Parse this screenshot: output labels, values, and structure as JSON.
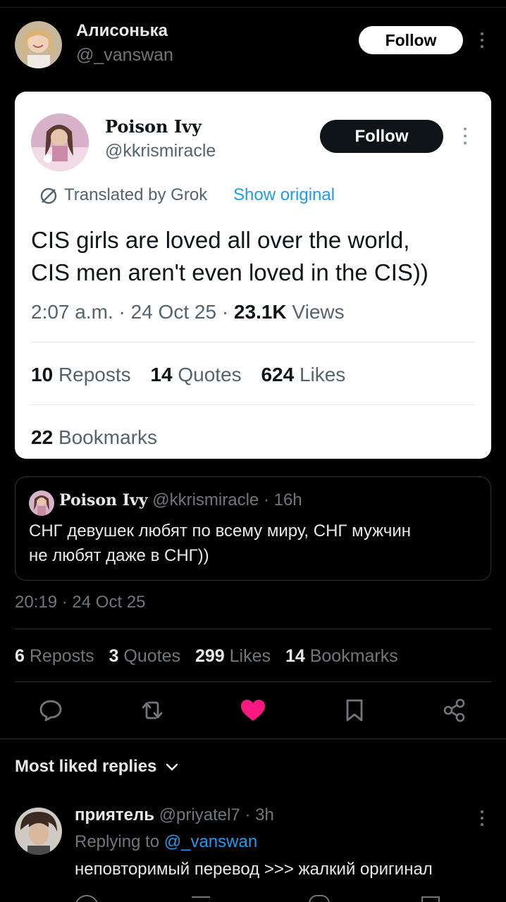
{
  "author": {
    "name": "Алисонька",
    "handle": "@_vanswan",
    "follow_label": "Follow"
  },
  "card": {
    "name": "Poison Ivy",
    "handle": "@kkrismiracle",
    "follow_label": "Follow",
    "translated_label": "Translated by Grok",
    "show_original_label": "Show original",
    "text_line1": "CIS girls are loved all over the world,",
    "text_line2": "CIS men aren't even loved in the CIS))",
    "time": "2:07 a.m.",
    "date": "24 Oct 25",
    "views_count": "23.1K",
    "views_label": "Views",
    "reposts_count": "10",
    "reposts_label": "Reposts",
    "quotes_count": "14",
    "quotes_label": "Quotes",
    "likes_count": "624",
    "likes_label": "Likes",
    "bookmarks_count": "22",
    "bookmarks_label": "Bookmarks"
  },
  "quote": {
    "name": "Poison Ivy",
    "handle": "@kkrismiracle",
    "age": "16h",
    "text_line1": "СНГ девушек любят по всему миру, СНГ мужчин",
    "text_line2": "не любят даже в СНГ))"
  },
  "post": {
    "time": "20:19",
    "date": "24 Oct 25",
    "reposts_count": "6",
    "reposts_label": "Reposts",
    "quotes_count": "3",
    "quotes_label": "Quotes",
    "likes_count": "299",
    "likes_label": "Likes",
    "bookmarks_count": "14",
    "bookmarks_label": "Bookmarks"
  },
  "actions": {
    "icons": [
      "reply-icon",
      "repost-icon",
      "like-icon",
      "bookmark-icon",
      "share-icon"
    ],
    "like_color": "#f91880"
  },
  "replies": {
    "sort_label": "Most liked replies",
    "items": [
      {
        "name": "приятель",
        "handle": "@priyatel7",
        "age": "3h",
        "replying_prefix": "Replying to",
        "replying_handle": "@_vanswan",
        "text": "неповторимый перевод >>> жалкий оригинал"
      }
    ]
  },
  "colors": {
    "background": "#000000",
    "text": "#e7e9ea",
    "muted": "#71767b",
    "link": "#1d9bf0",
    "border": "#2f3336"
  }
}
